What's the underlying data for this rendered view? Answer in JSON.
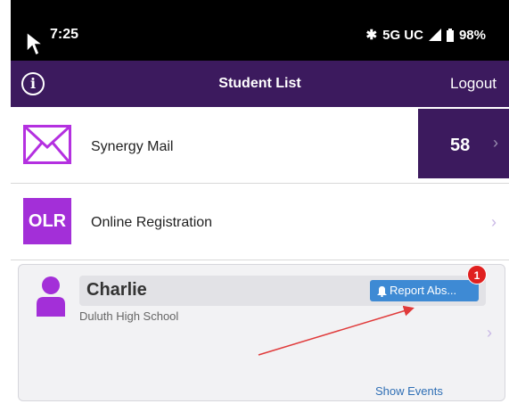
{
  "status_bar": {
    "time": "7:25",
    "indicators": "5G UC",
    "battery": "98%",
    "icons": [
      "bluetooth-icon",
      "signal-icon",
      "battery-icon"
    ]
  },
  "header": {
    "title": "Student List",
    "logout_label": "Logout",
    "info_symbol": "i",
    "background": "#3c1a5e"
  },
  "menu": {
    "mail": {
      "label": "Synergy Mail",
      "count": "58",
      "icon": "mail-icon"
    },
    "registration": {
      "label": "Online Registration",
      "icon_text": "OLR"
    }
  },
  "student": {
    "name": "Charlie",
    "school": "Duluth High School",
    "report_label": "Report Abs...",
    "badge_count": "1",
    "show_events_label": "Show Events"
  },
  "colors": {
    "brand_purple": "#3c1a5e",
    "accent_magenta": "#a32fd8",
    "button_blue": "#3e8ad4",
    "badge_red": "#e02020",
    "annotation_arrow": "#e03a3a"
  }
}
